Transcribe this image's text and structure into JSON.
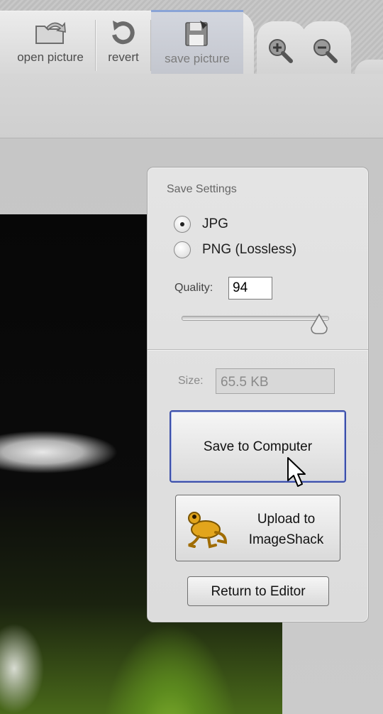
{
  "toolbar": {
    "open_label": "open picture",
    "revert_label": "revert",
    "save_label": "save picture",
    "zoom_in_icon": "zoom-in-icon",
    "zoom_out_icon": "zoom-out-icon"
  },
  "panel": {
    "title": "Save Settings",
    "formats": [
      {
        "label": "JPG",
        "selected": true
      },
      {
        "label": "PNG (Lossless)",
        "selected": false
      }
    ],
    "quality_label": "Quality:",
    "quality_value": "94",
    "quality_fraction": 0.94,
    "size_label": "Size:",
    "size_value": "65.5 KB",
    "save_button": "Save to Computer",
    "upload_line1": "Upload to",
    "upload_line2": "ImageShack",
    "return_button": "Return to Editor"
  },
  "colors": {
    "accent": "#3c4fa8",
    "frog": "#e2a51c"
  }
}
